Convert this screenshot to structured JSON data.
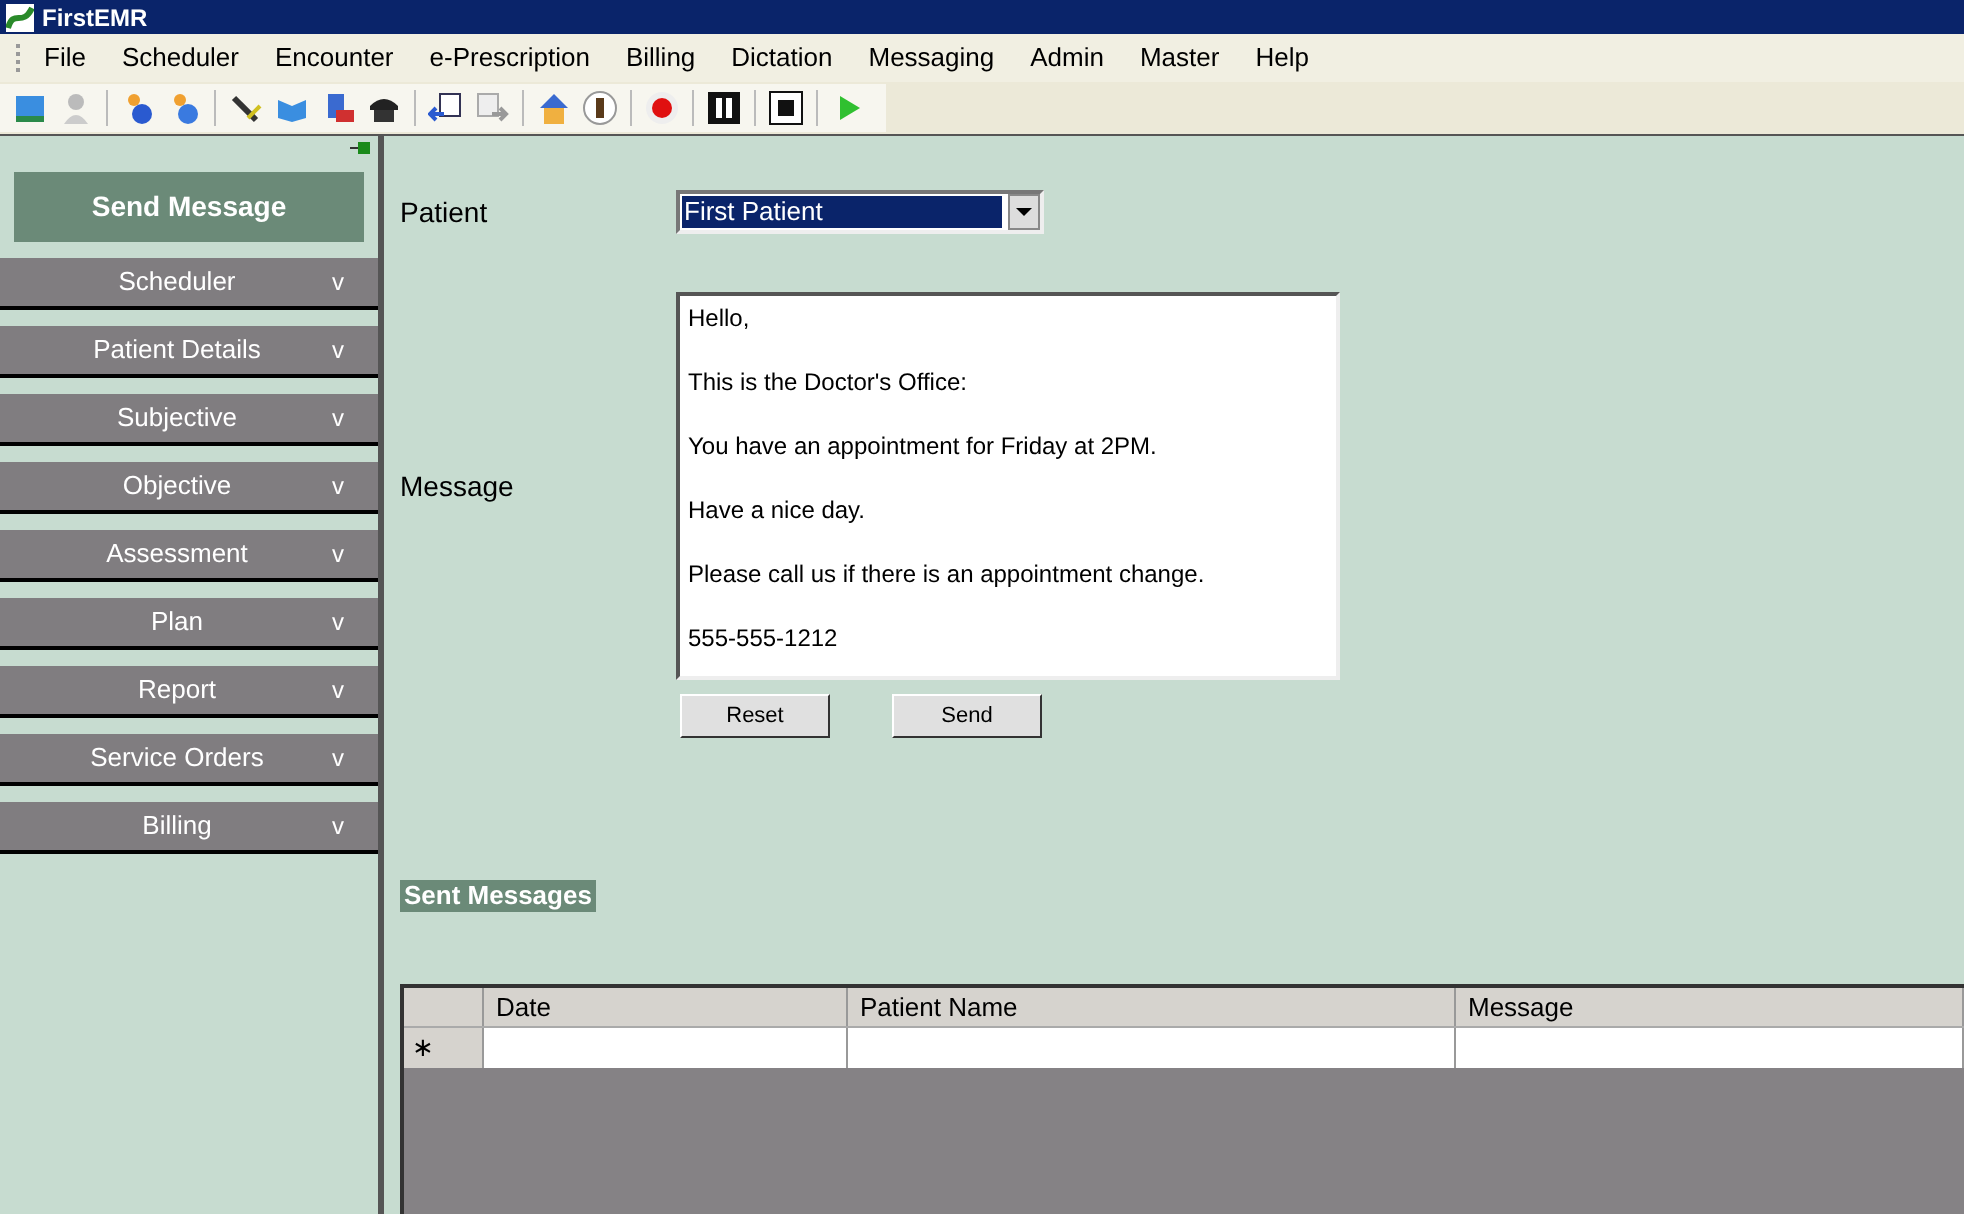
{
  "window": {
    "title": "FirstEMR"
  },
  "menu": [
    "File",
    "Scheduler",
    "Encounter",
    "e-Prescription",
    "Billing",
    "Dictation",
    "Messaging",
    "Admin",
    "Master",
    "Help"
  ],
  "sidebar": {
    "title": "Send Message",
    "items": [
      {
        "label": "Scheduler",
        "expander": "v"
      },
      {
        "label": "Patient Details",
        "expander": "v"
      },
      {
        "label": "Subjective",
        "expander": "v"
      },
      {
        "label": "Objective",
        "expander": "v"
      },
      {
        "label": "Assessment",
        "expander": "v"
      },
      {
        "label": "Plan",
        "expander": "v"
      },
      {
        "label": "Report",
        "expander": "v"
      },
      {
        "label": "Service Orders",
        "expander": "v"
      },
      {
        "label": "Billing",
        "expander": "v"
      }
    ]
  },
  "form": {
    "patient_label": "Patient",
    "patient_value": "First Patient",
    "message_label": "Message",
    "message_lines": [
      "Hello,",
      "This is the Doctor's Office:",
      "You have an appointment for Friday at 2PM.",
      "Have a nice day.",
      "Please call us if there is an appointment change.",
      "555-555-1212"
    ],
    "buttons": [
      "Reset",
      "Send"
    ]
  },
  "sent_messages": {
    "title": "Sent Messages",
    "columns": [
      "Date",
      "Patient Name",
      "Message"
    ],
    "new_row_marker": "∗"
  }
}
